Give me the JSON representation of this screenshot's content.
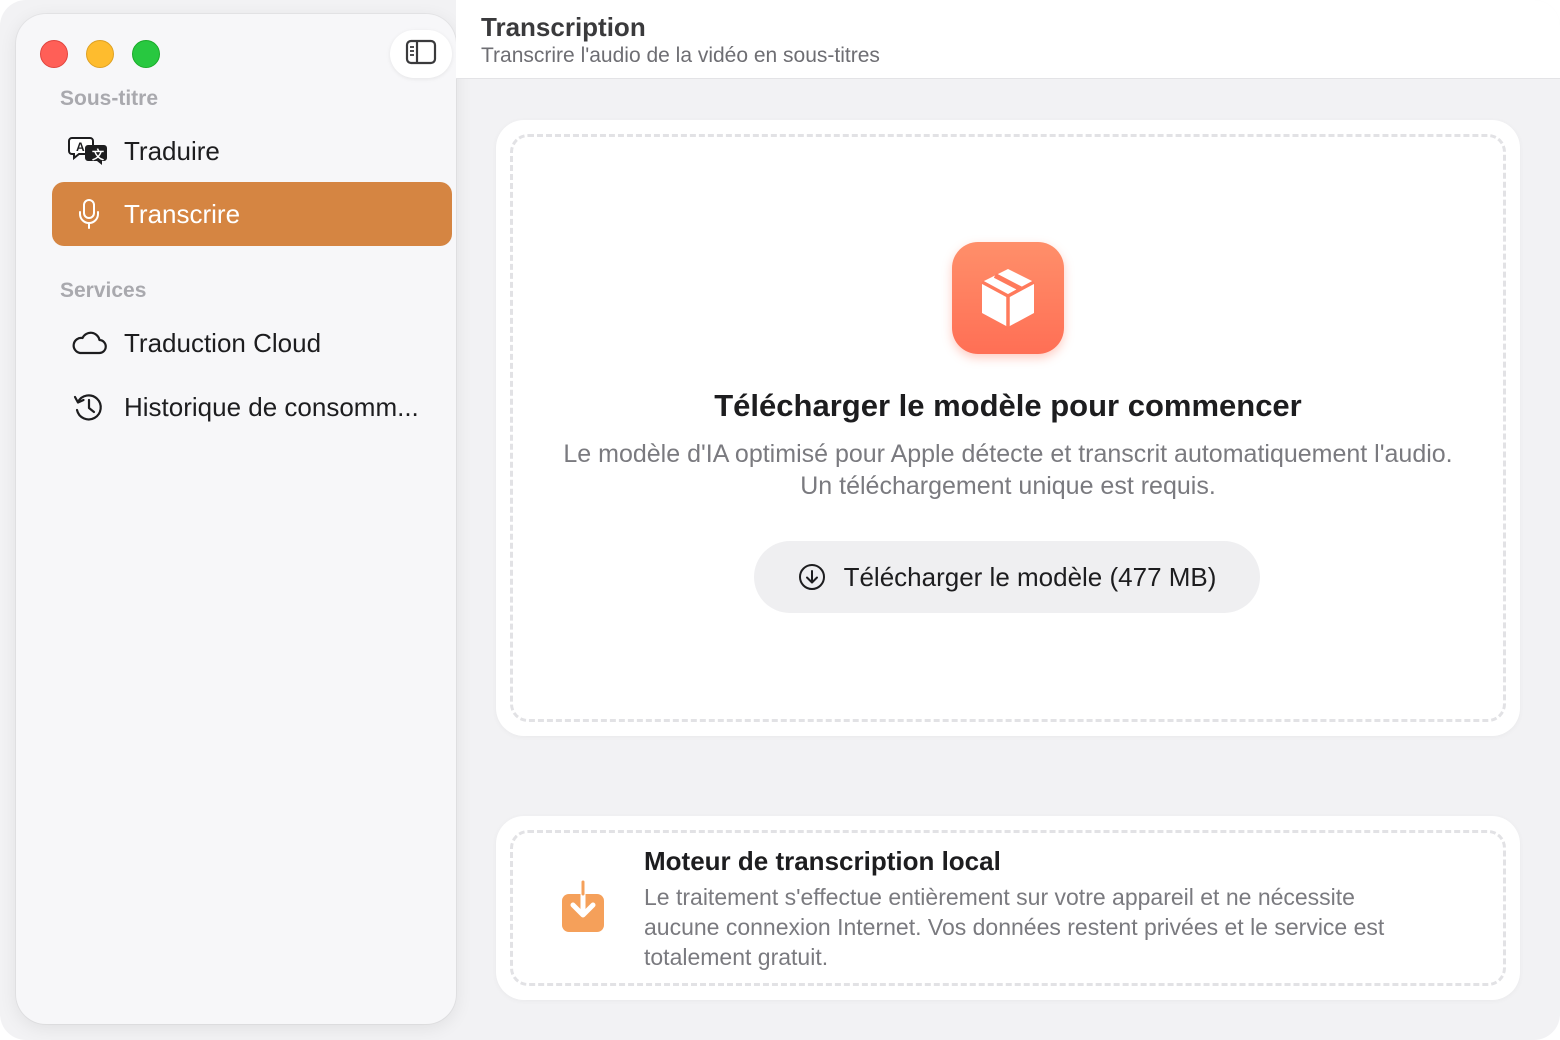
{
  "header": {
    "title": "Transcription",
    "subtitle": "Transcrire l'audio de la vidéo en sous-titres"
  },
  "sidebar": {
    "sections": [
      {
        "label": "Sous-titre",
        "items": [
          {
            "label": "Traduire",
            "icon": "translate-icon",
            "active": false
          },
          {
            "label": "Transcrire",
            "icon": "microphone-icon",
            "active": true
          }
        ]
      },
      {
        "label": "Services",
        "items": [
          {
            "label": "Traduction Cloud",
            "icon": "cloud-icon",
            "active": false
          },
          {
            "label": "Historique de consomm...",
            "icon": "history-icon",
            "active": false
          }
        ]
      }
    ]
  },
  "main": {
    "title": "Télécharger le modèle pour commencer",
    "description": "Le modèle d'IA optimisé pour Apple détecte et transcrit automatiquement l'audio. Un téléchargement unique est requis.",
    "download_button": "Télécharger le modèle (477 MB)"
  },
  "local_engine": {
    "title": "Moteur de transcription local",
    "description": "Le traitement s'effectue entièrement sur votre appareil et ne nécessite aucune connexion Internet. Vos données restent privées et le service est totalement gratuit."
  },
  "colors": {
    "accent": "#d58542",
    "model_icon": "#ff7a5c",
    "local_icon": "#f5a05a"
  }
}
